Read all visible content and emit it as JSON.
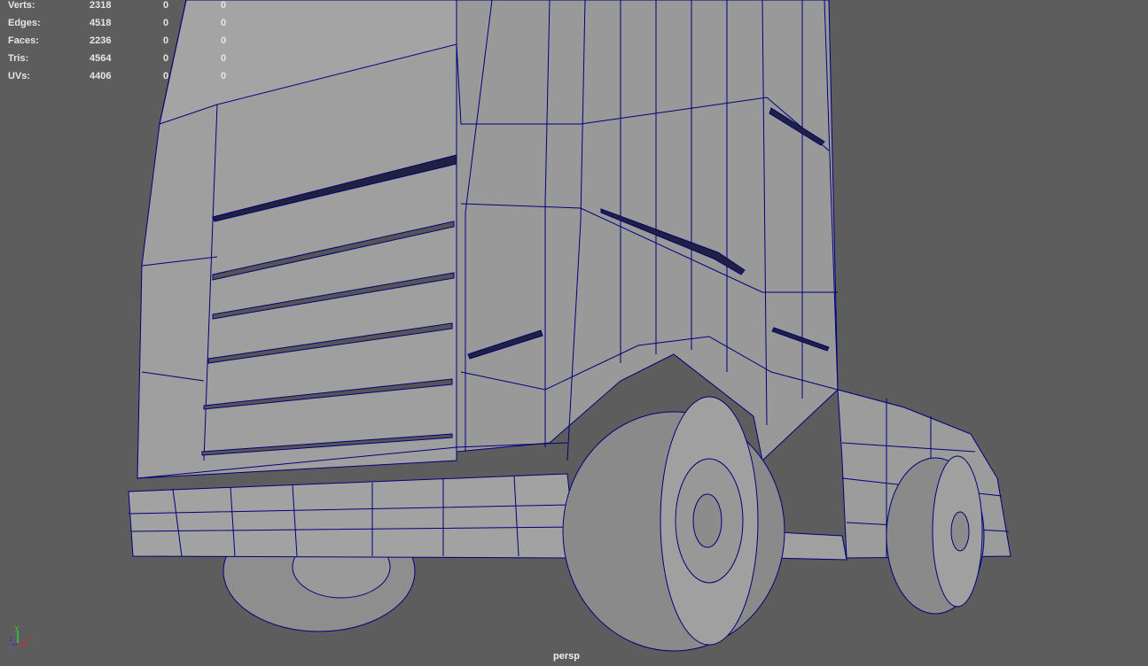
{
  "hud": {
    "rows": [
      {
        "label": "Verts:",
        "total": "2318",
        "selected": "0",
        "third": "0"
      },
      {
        "label": "Edges:",
        "total": "4518",
        "selected": "0",
        "third": "0"
      },
      {
        "label": "Faces:",
        "total": "2236",
        "selected": "0",
        "third": "0"
      },
      {
        "label": "Tris:",
        "total": "4564",
        "selected": "0",
        "third": "0"
      },
      {
        "label": "UVs:",
        "total": "4406",
        "selected": "0",
        "third": "0"
      }
    ]
  },
  "camera": {
    "name": "persp"
  },
  "axis": {
    "x": "x",
    "y": "y",
    "z": "z"
  },
  "colors": {
    "background": "#5d5d5d",
    "mesh": "#a0a0a0",
    "wire": "#00007a"
  }
}
